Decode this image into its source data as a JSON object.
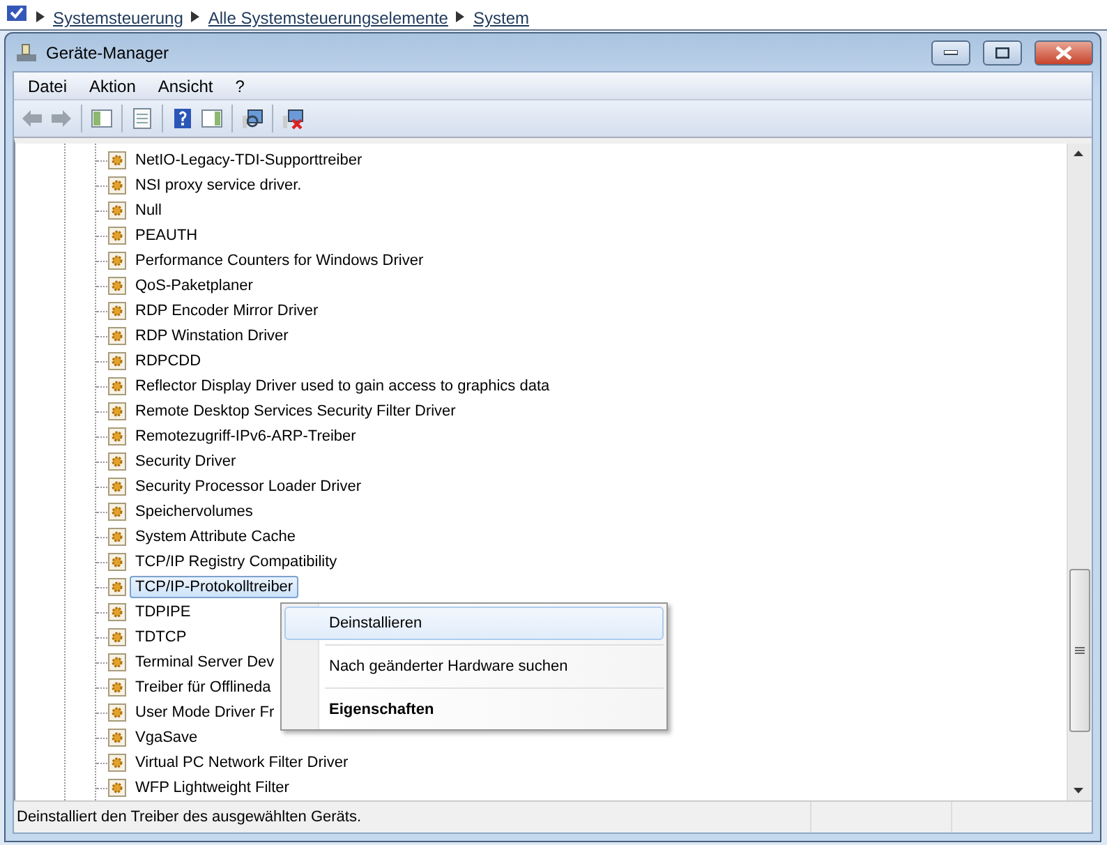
{
  "breadcrumb": [
    "Systemsteuerung",
    "Alle Systemsteuerungselemente",
    "System"
  ],
  "window": {
    "title": "Geräte-Manager"
  },
  "menu": [
    "Datei",
    "Aktion",
    "Ansicht",
    "?"
  ],
  "toolbar": [
    {
      "kind": "back"
    },
    {
      "kind": "forward"
    },
    {
      "kind": "tree"
    },
    {
      "kind": "properties"
    },
    {
      "kind": "help"
    },
    {
      "kind": "pane"
    },
    {
      "kind": "scan"
    },
    {
      "kind": "uninstall"
    }
  ],
  "tree": {
    "items": [
      {
        "label": "NetIO-Legacy-TDI-Supporttreiber",
        "selected": false
      },
      {
        "label": "NSI proxy service driver.",
        "selected": false
      },
      {
        "label": "Null",
        "selected": false
      },
      {
        "label": "PEAUTH",
        "selected": false
      },
      {
        "label": "Performance Counters for Windows Driver",
        "selected": false
      },
      {
        "label": "QoS-Paketplaner",
        "selected": false
      },
      {
        "label": "RDP Encoder Mirror Driver",
        "selected": false
      },
      {
        "label": "RDP Winstation Driver",
        "selected": false
      },
      {
        "label": "RDPCDD",
        "selected": false
      },
      {
        "label": "Reflector Display Driver used to gain access to graphics data",
        "selected": false
      },
      {
        "label": "Remote Desktop Services Security Filter Driver",
        "selected": false
      },
      {
        "label": "Remotezugriff-IPv6-ARP-Treiber",
        "selected": false
      },
      {
        "label": "Security Driver",
        "selected": false
      },
      {
        "label": "Security Processor Loader Driver",
        "selected": false
      },
      {
        "label": "Speichervolumes",
        "selected": false
      },
      {
        "label": "System Attribute Cache",
        "selected": false
      },
      {
        "label": "TCP/IP Registry Compatibility",
        "selected": false
      },
      {
        "label": "TCP/IP-Protokolltreiber",
        "selected": true
      },
      {
        "label": "TDPIPE",
        "selected": false
      },
      {
        "label": "TDTCP",
        "selected": false
      },
      {
        "label": "Terminal Server Dev",
        "selected": false
      },
      {
        "label": "Treiber für Offlineda",
        "selected": false
      },
      {
        "label": "User Mode Driver Fr",
        "selected": false
      },
      {
        "label": "VgaSave",
        "selected": false
      },
      {
        "label": "Virtual PC Network Filter Driver",
        "selected": false
      },
      {
        "label": "WFP Lightweight Filter",
        "selected": false
      }
    ]
  },
  "context_menu": [
    {
      "label": "Deinstallieren",
      "selected": true,
      "default": false
    },
    {
      "label": "Nach geänderter Hardware suchen",
      "selected": false,
      "default": false
    },
    {
      "label": "Eigenschaften",
      "selected": false,
      "default": true
    }
  ],
  "status_bar": "Deinstalliert den Treiber des ausgewählten Geräts."
}
